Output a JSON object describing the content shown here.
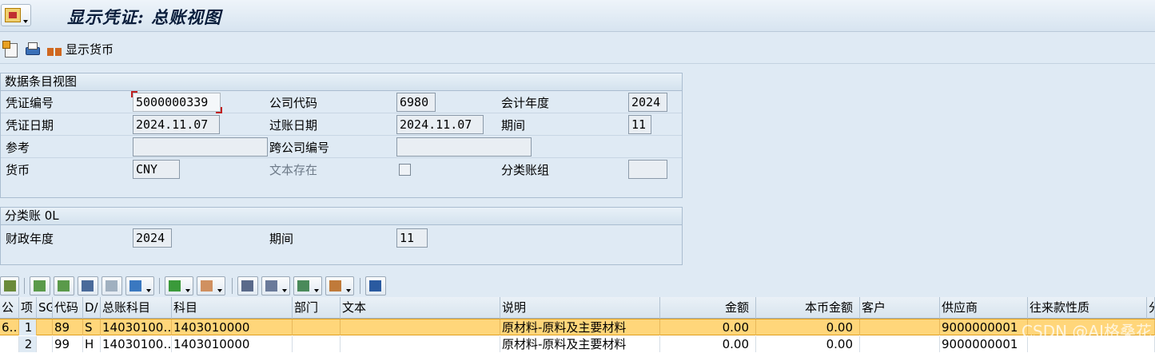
{
  "title": "显示凭证: 总账视图",
  "toolbar": {
    "display_currency_label": "显示货币"
  },
  "doc_group": {
    "header": "数据条目视图",
    "doc_number_label": "凭证编号",
    "doc_number": "5000000339",
    "company_code_label": "公司代码",
    "company_code": "6980",
    "fiscal_year_label": "会计年度",
    "fiscal_year": "2024",
    "doc_date_label": "凭证日期",
    "doc_date": "2024.11.07",
    "posting_date_label": "过账日期",
    "posting_date": "2024.11.07",
    "period_label": "期间",
    "period": "11",
    "reference_label": "参考",
    "reference": "",
    "cross_cc_label": "跨公司编号",
    "cross_cc": "",
    "currency_label": "货币",
    "currency": "CNY",
    "text_exists_label": "文本存在",
    "text_exists": false,
    "ledger_group_label": "分类账组",
    "ledger_group": ""
  },
  "ledger_group": {
    "header": "分类账 0L",
    "fiscal_year_label": "财政年度",
    "fiscal_year": "2024",
    "period_label": "期间",
    "period": "11"
  },
  "table": {
    "columns": [
      "公",
      "项",
      "SG",
      "代码",
      "D/",
      "总账科目",
      "科目",
      "部门",
      "文本",
      "说明",
      "金额",
      "本币金额",
      "客户",
      "供应商",
      "往来款性质",
      "分"
    ],
    "rows": [
      {
        "co": "6…",
        "item": "1",
        "sg": "",
        "code": "89",
        "dc": "S",
        "gl": "14030100…",
        "acct": "1403010000",
        "dept": "",
        "text": "",
        "desc": "原材料-原料及主要材料",
        "amount": "0.00",
        "local": "0.00",
        "customer": "",
        "vendor": "9000000001",
        "nature": ""
      },
      {
        "co": "",
        "item": "2",
        "sg": "",
        "code": "99",
        "dc": "H",
        "gl": "14030100…",
        "acct": "1403010000",
        "dept": "",
        "text": "",
        "desc": "原材料-原料及主要材料",
        "amount": "0.00",
        "local": "0.00",
        "customer": "",
        "vendor": "9000000001",
        "nature": ""
      }
    ]
  },
  "watermark": "CSDN @AI格桑花",
  "colors": {
    "selected_row": "#ffd67a",
    "background": "#dfeaf4"
  }
}
